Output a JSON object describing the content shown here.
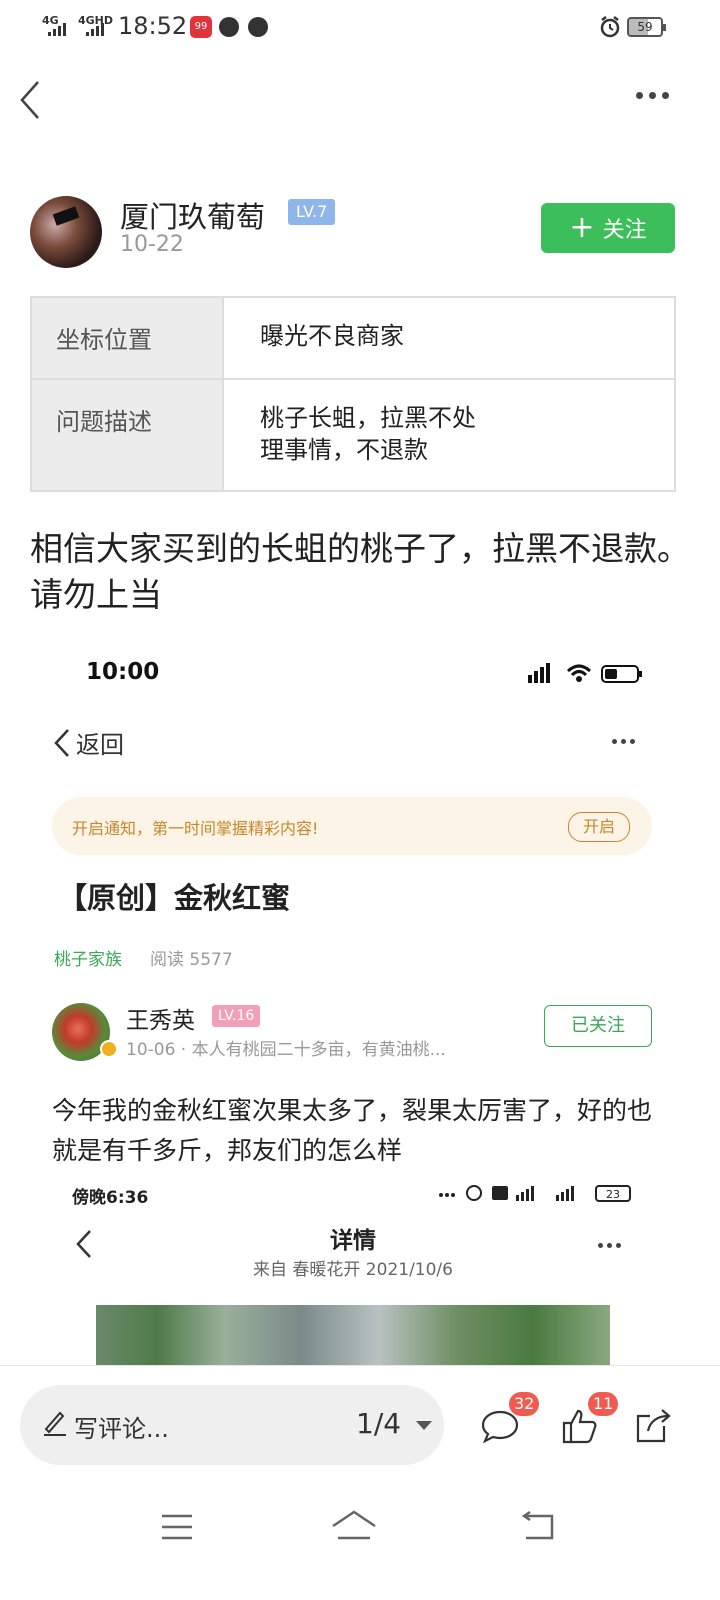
{
  "status_bar": {
    "signal1": "4G",
    "signal2": "4GHD",
    "time": "18:52",
    "notif_badge": "99",
    "battery": "59"
  },
  "header": {
    "back_icon": "chevron-left-icon",
    "more_icon": "more-horizontal-icon"
  },
  "author": {
    "name": "厦门玖葡萄",
    "level": "LV.7",
    "date": "10-22",
    "follow_label": "关注",
    "follow_color": "#3cbf5a"
  },
  "info_table": {
    "rows": [
      {
        "key": "坐标位置",
        "value": "曝光不良商家"
      },
      {
        "key": "问题描述",
        "value": "桃子长蛆，拉黑不处理事情，不退款"
      }
    ]
  },
  "post": {
    "text": "相信大家买到的长蛆的桃子了，拉黑不退款。请勿上当"
  },
  "embedded": {
    "time": "10:00",
    "back_label": "返回",
    "notice_text": "开启通知，第一时间掌握精彩内容!",
    "notice_button": "开启",
    "title": "【原创】金秋红蜜",
    "group": "桃子家族",
    "reads": "阅读 5577",
    "user_name": "王秀英",
    "user_level": "LV.16",
    "user_meta": "10-06 · 本人有桃园二十多亩，有黄油桃...",
    "followed_label": "已关注",
    "post_text": "今年我的金秋红蜜次果太多了，裂果太厉害了，好的也就是有千多斤，邦友们的怎么样"
  },
  "embedded2": {
    "time": "傍晚6:36",
    "battery": "23",
    "title": "详情",
    "subtitle": "来自 春暖花开 2021/10/6"
  },
  "bottom_bar": {
    "comment_placeholder": "写评论...",
    "page_indicator": "1/4",
    "comment_count": "32",
    "like_count": "11",
    "badge_color": "#f05a4f"
  }
}
